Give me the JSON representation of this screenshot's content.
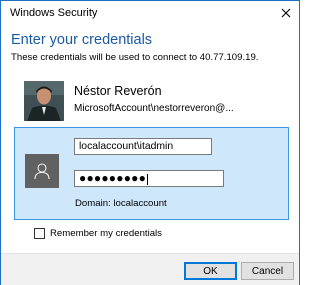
{
  "window": {
    "title": "Windows Security"
  },
  "dialog": {
    "heading": "Enter your credentials",
    "subheading": "These credentials will be used to connect to 40.77.109.19."
  },
  "account": {
    "name": "Néstor Reverón",
    "id": "MicrosoftAccount\\nestorreveron@..."
  },
  "credential_tile": {
    "username_value": "localaccount\\itadmin",
    "password_masked": "●●●●●●●●●",
    "domain_text": "Domain: localaccount"
  },
  "remember": {
    "label": "Remember my credentials",
    "checked": false
  },
  "buttons": {
    "ok_label": "OK",
    "cancel_label": "Cancel"
  },
  "icons": {
    "close": "close-icon",
    "user": "user-icon"
  },
  "colors": {
    "accent": "#1a5aa6",
    "tile_bg": "#cfe7fb",
    "tile_border": "#3c97e0",
    "ok_border": "#0078d7"
  }
}
